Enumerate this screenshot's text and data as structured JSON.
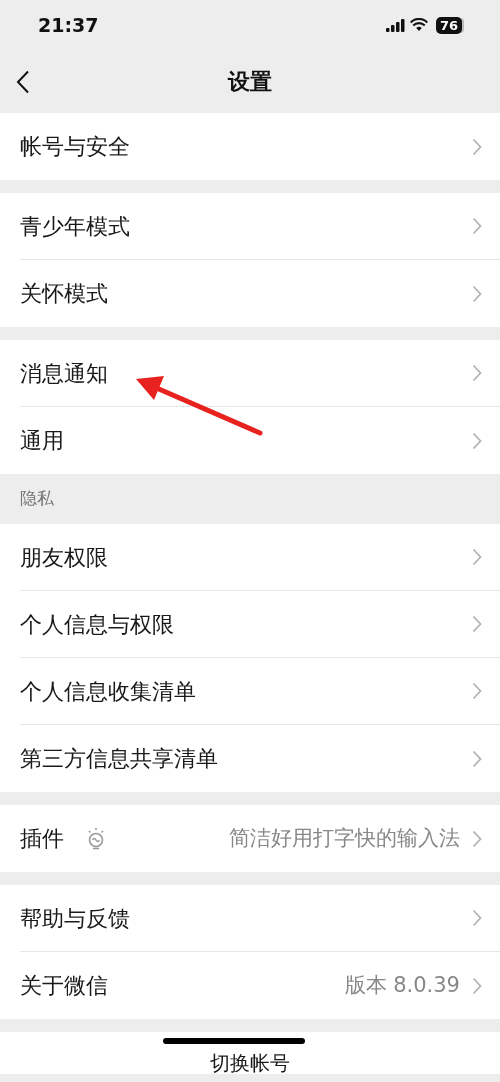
{
  "status_bar": {
    "time": "21:37",
    "battery": "76"
  },
  "nav": {
    "title": "设置"
  },
  "groups": [
    {
      "items": [
        {
          "label": "帐号与安全",
          "kind": "link"
        }
      ]
    },
    {
      "items": [
        {
          "label": "青少年模式",
          "kind": "link"
        },
        {
          "label": "关怀模式",
          "kind": "link"
        }
      ]
    },
    {
      "items": [
        {
          "label": "消息通知",
          "kind": "link"
        },
        {
          "label": "通用",
          "kind": "link"
        }
      ]
    },
    {
      "header": "隐私",
      "items": [
        {
          "label": "朋友权限",
          "kind": "link"
        },
        {
          "label": "个人信息与权限",
          "kind": "link"
        },
        {
          "label": "个人信息收集清单",
          "kind": "link"
        },
        {
          "label": "第三方信息共享清单",
          "kind": "link"
        }
      ]
    },
    {
      "items": [
        {
          "label": "插件",
          "kind": "plugin",
          "value": "简洁好用打字快的输入法"
        }
      ]
    },
    {
      "items": [
        {
          "label": "帮助与反馈",
          "kind": "link"
        },
        {
          "label": "关于微信",
          "kind": "link",
          "value": "版本 8.0.39"
        }
      ]
    }
  ],
  "footer_button": "切换帐号"
}
